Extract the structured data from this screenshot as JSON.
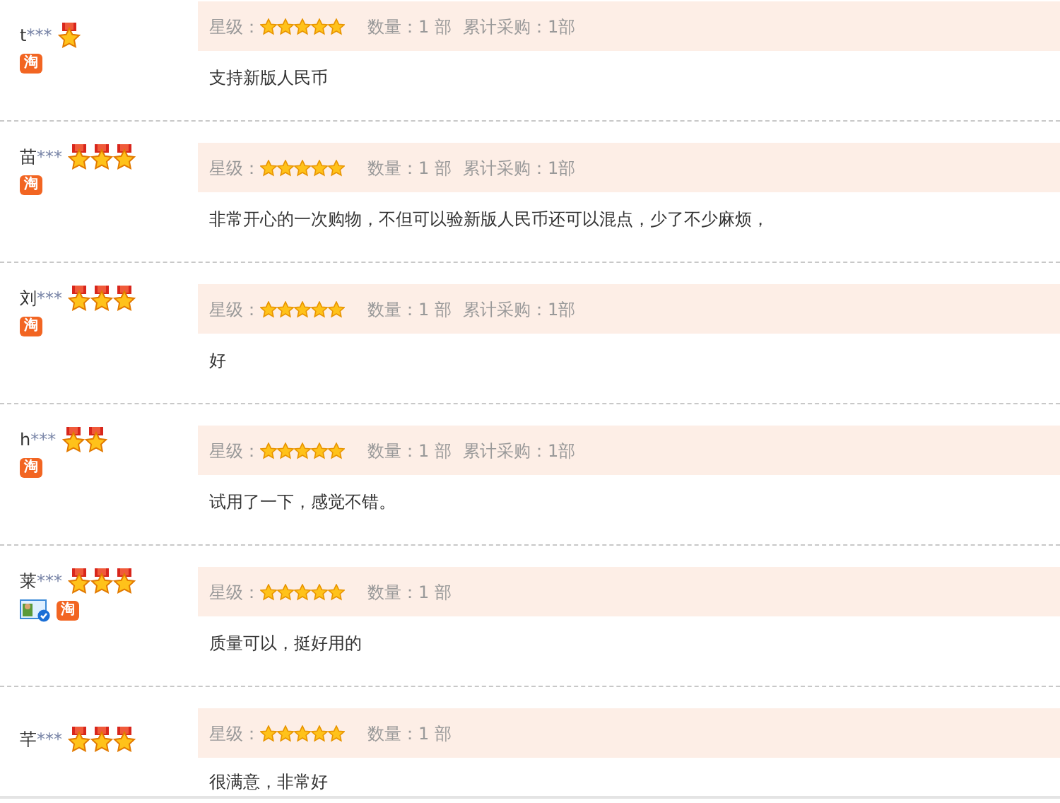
{
  "reviews": [
    {
      "user": "t",
      "masked": "***",
      "medals": [
        {
          "kind": "medal"
        }
      ],
      "badges": [
        {
          "kind": "taobao",
          "label": "淘"
        }
      ],
      "rating_label": "星级：",
      "stars": 5,
      "quantity": "数量：1 部",
      "total": "累计采购：1部",
      "comment": "支持新版人民币"
    },
    {
      "user": "苗",
      "masked": "***",
      "medals": [
        {
          "kind": "medal"
        },
        {
          "kind": "medal"
        },
        {
          "kind": "medal"
        }
      ],
      "badges": [
        {
          "kind": "taobao",
          "label": "淘"
        }
      ],
      "rating_label": "星级：",
      "stars": 5,
      "quantity": "数量：1 部",
      "total": "累计采购：1部",
      "comment": "非常开心的一次购物，不但可以验新版人民币还可以混点，少了不少麻烦，"
    },
    {
      "user": "刘",
      "masked": "***",
      "medals": [
        {
          "kind": "medal"
        },
        {
          "kind": "medal"
        },
        {
          "kind": "medal"
        }
      ],
      "badges": [
        {
          "kind": "taobao",
          "label": "淘"
        }
      ],
      "rating_label": "星级：",
      "stars": 5,
      "quantity": "数量：1 部",
      "total": "累计采购：1部",
      "comment": "好"
    },
    {
      "user": "h",
      "masked": "***",
      "medals": [
        {
          "kind": "medal"
        },
        {
          "kind": "medal"
        }
      ],
      "badges": [
        {
          "kind": "taobao",
          "label": "淘"
        }
      ],
      "rating_label": "星级：",
      "stars": 5,
      "quantity": "数量：1 部",
      "total": "累计采购：1部",
      "comment": "试用了一下，感觉不错。"
    },
    {
      "user": "莱",
      "masked": "***",
      "medals": [
        {
          "kind": "medal"
        },
        {
          "kind": "medal"
        },
        {
          "kind": "medal"
        }
      ],
      "badges": [
        {
          "kind": "verified-id"
        },
        {
          "kind": "taobao",
          "label": "淘"
        }
      ],
      "rating_label": "星级：",
      "stars": 5,
      "quantity": "数量：1 部",
      "comment": "质量可以，挺好用的"
    },
    {
      "user": "芊",
      "masked": "***",
      "medals": [
        {
          "kind": "medal"
        },
        {
          "kind": "medal"
        },
        {
          "kind": "medal"
        }
      ],
      "rating_label": "星级：",
      "stars": 5,
      "quantity": "数量：1 部",
      "comment": "很满意，非常好"
    }
  ]
}
